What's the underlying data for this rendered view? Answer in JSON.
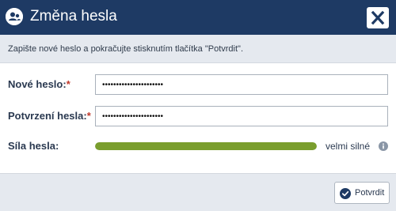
{
  "dialog": {
    "title": "Změna hesla",
    "title_icon": "user-icon",
    "close_icon": "close-icon"
  },
  "info": {
    "text": "Zapište nové heslo a pokračujte stisknutím tlačítka \"Potvrdit\"."
  },
  "form": {
    "new_password": {
      "label": "Nové heslo:",
      "required_mark": "*",
      "value": "••••••••••••••••••••••"
    },
    "confirm_password": {
      "label": "Potvrzení hesla:",
      "required_mark": "*",
      "value": "••••••••••••••••••••••"
    },
    "strength": {
      "label": "Síla hesla:",
      "level_percent": 100,
      "text": "velmi silné",
      "bar_color": "#7a9e2e",
      "info_icon": "info-icon"
    }
  },
  "footer": {
    "confirm_label": "Potvrdit",
    "confirm_icon": "check-circle-icon"
  },
  "colors": {
    "header_bg": "#1e3a64",
    "panel_bg": "#e5e9ef",
    "required": "#c0392b"
  }
}
